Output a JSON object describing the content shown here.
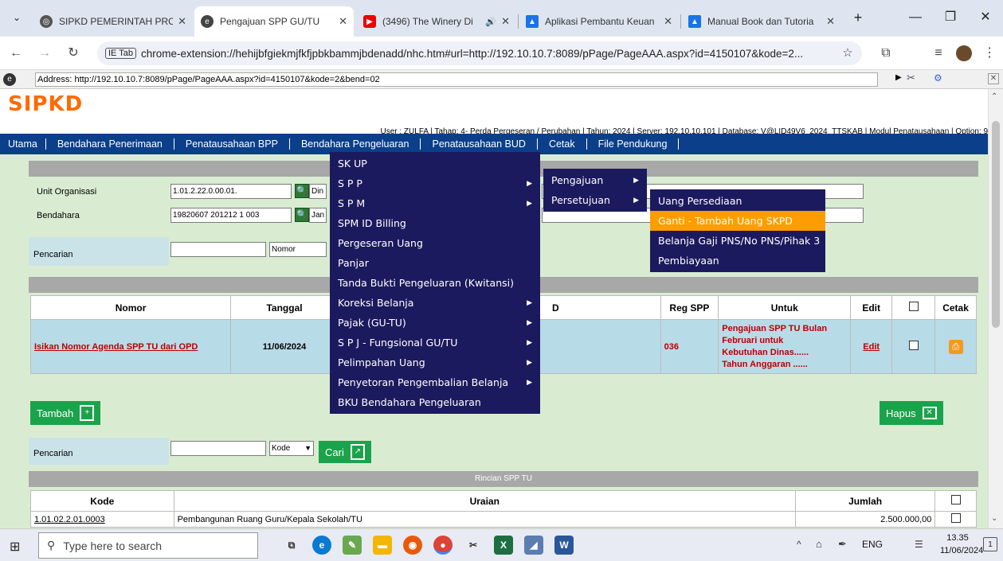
{
  "browser": {
    "tabs": [
      {
        "label": "SIPKD PEMERINTAH PRO",
        "icon": "globe-icon"
      },
      {
        "label": "Pengajuan SPP GU/TU",
        "icon": "ie-tab-icon"
      },
      {
        "label": "(3496) The Winery Di",
        "icon": "youtube-icon"
      },
      {
        "label": "Aplikasi Pembantu Keuan",
        "icon": "drive-icon"
      },
      {
        "label": "Manual Book dan Tutoria",
        "icon": "drive-icon"
      }
    ],
    "new_tab": "+",
    "minimize": "—",
    "restore": "❐",
    "close": "✕",
    "ie_tab_chip": "IE Tab",
    "url": "chrome-extension://hehijbfgiekmjfkfjpbkbammjbdenadd/nhc.htm#url=http://192.10.10.7:8089/pPage/PageAAA.aspx?id=4150107&kode=2...",
    "ie_address_label": "Address:",
    "ie_address": "http://192.10.10.7:8089/pPage/PageAAA.aspx?id=4150107&kode=2&bend=02"
  },
  "app": {
    "logo": "SIPKD",
    "user_line": "User : ZULFA | Tahap: 4- Perda Pergeseran / Perubahan | Tahun: 2024 | Server: 192.10.10.101 | Database: V@LID49V6_2024_TTSKAB | Modul Penatausahaan | Option: 9",
    "menu": [
      "Utama",
      "Bendahara Penerimaan",
      "Penatausahaan BPP",
      "Bendahara Pengeluaran",
      "Penatausahaan BUD",
      "Cetak",
      "File Pendukung"
    ]
  },
  "form": {
    "unit_label": "Unit Organisasi",
    "unit_code": "1.01.2.22.0.00.01.",
    "unit_name": "Din",
    "bendahara_label": "Bendahara",
    "bendahara_code": "19820607 201212 1 003",
    "bendahara_name": "Jan",
    "pencarian_label": "Pencarian",
    "pencarian_value": "",
    "pencarian_select": "Nomor"
  },
  "table": {
    "headers": [
      "Nomor",
      "Tanggal",
      "D",
      "Reg SPP",
      "Untuk",
      "Edit",
      "Cetak"
    ],
    "row": {
      "nomor": "Isikan Nomor Agenda SPP TU dari OPD",
      "tanggal": "11/06/2024",
      "reg": "036",
      "untuk": [
        "Pengajuan SPP TU Bulan",
        "Februari untuk",
        "Kebutuhan Dinas......",
        "Tahun Anggaran ......"
      ],
      "edit": "Edit"
    }
  },
  "buttons": {
    "tambah": "Tambah",
    "hapus": "Hapus",
    "cari": "Cari"
  },
  "search2": {
    "label": "Pencarian",
    "value": "",
    "select": "Kode"
  },
  "rincian": {
    "title": "Rincian SPP TU",
    "headers": [
      "Kode",
      "Uraian",
      "Jumlah"
    ],
    "row": {
      "kode": "1.01.02.2.01.0003",
      "uraian": "Pembangunan Ruang Guru/Kepala Sekolah/TU",
      "jumlah": "2.500.000,00"
    }
  },
  "menu_level1": [
    {
      "label": "SK UP",
      "sub": false
    },
    {
      "label": "S P P",
      "sub": true
    },
    {
      "label": "S P M",
      "sub": true
    },
    {
      "label": "SPM ID Billing",
      "sub": false
    },
    {
      "label": "Pergeseran Uang",
      "sub": false
    },
    {
      "label": "Panjar",
      "sub": false
    },
    {
      "label": "Tanda Bukti Pengeluaran (Kwitansi)",
      "sub": false
    },
    {
      "label": "Koreksi Belanja",
      "sub": true
    },
    {
      "label": "Pajak (GU-TU)",
      "sub": true
    },
    {
      "label": "S P J - Fungsional GU/TU",
      "sub": true
    },
    {
      "label": "Pelimpahan Uang",
      "sub": true
    },
    {
      "label": "Penyetoran Pengembalian Belanja",
      "sub": true
    },
    {
      "label": "BKU Bendahara Pengeluaran",
      "sub": false
    }
  ],
  "menu_level2": [
    {
      "label": "Pengajuan",
      "sub": true
    },
    {
      "label": "Persetujuan",
      "sub": true
    }
  ],
  "menu_level3": [
    {
      "label": "Uang Persediaan",
      "highlight": false
    },
    {
      "label": "Ganti - Tambah Uang SKPD",
      "highlight": true
    },
    {
      "label": "Belanja Gaji PNS/No PNS/Pihak 3",
      "highlight": false
    },
    {
      "label": "Pembiayaan",
      "highlight": false
    }
  ],
  "taskbar": {
    "search_placeholder": "Type here to search",
    "lang": "ENG",
    "time": "13.35",
    "date": "11/06/2024",
    "notif": "1"
  }
}
